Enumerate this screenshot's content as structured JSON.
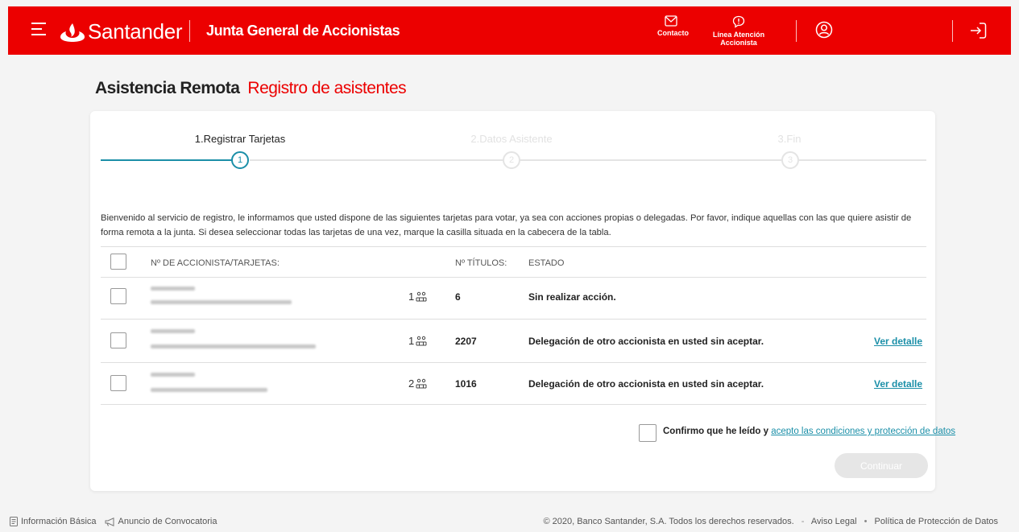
{
  "header": {
    "brand": "Santander",
    "app_title": "Junta General de Accionistas",
    "contact_label": "Contacto",
    "line_label": "Línea Atención Accionista",
    "colors": {
      "brand_red": "#ec0000"
    }
  },
  "page": {
    "title": "Asistencia Remota",
    "subtitle": "Registro de asistentes"
  },
  "stepper": {
    "steps": [
      {
        "label": "1.Registrar Tarjetas",
        "number": "1",
        "state": "active"
      },
      {
        "label": "2.Datos Asistente",
        "number": "2",
        "state": "pending"
      },
      {
        "label": "3.Fin",
        "number": "3",
        "state": "pending"
      }
    ],
    "accent": "#1b8fa8"
  },
  "intro_text": "Bienvenido al servicio de registro, le informamos que usted dispone de las siguientes tarjetas para votar, ya sea con acciones propias o delegadas. Por favor, indique aquellas con las que quiere asistir de forma remota a la junta. Si desea seleccionar todas las tarjetas de una vez, marque la casilla situada en la cabecera de la tabla.",
  "table": {
    "headers": {
      "accionista": "Nº DE ACCIONISTA/TARJETAS:",
      "titulos": "Nº TÍTULOS:",
      "estado": "ESTADO"
    },
    "rows": [
      {
        "count": "1",
        "titulos": "6",
        "estado": "Sin realizar acción.",
        "detail": ""
      },
      {
        "count": "1",
        "titulos": "2207",
        "estado": "Delegación de otro accionista en usted sin aceptar.",
        "detail": "Ver detalle"
      },
      {
        "count": "2",
        "titulos": "1016",
        "estado": "Delegación de otro accionista en usted sin aceptar.",
        "detail": "Ver detalle"
      }
    ]
  },
  "confirm": {
    "prefix": "Confirmo que he leído y",
    "link": "acepto las condiciones y protección de datos"
  },
  "continue_label": "Continuar",
  "footer": {
    "info": "Información Básica",
    "announcement": "Anuncio de Convocatoria",
    "copyright": "© 2020, Banco Santander, S.A. Todos los derechos reservados.",
    "legal": "Aviso Legal",
    "privacy": "Política de Protección de Datos"
  }
}
